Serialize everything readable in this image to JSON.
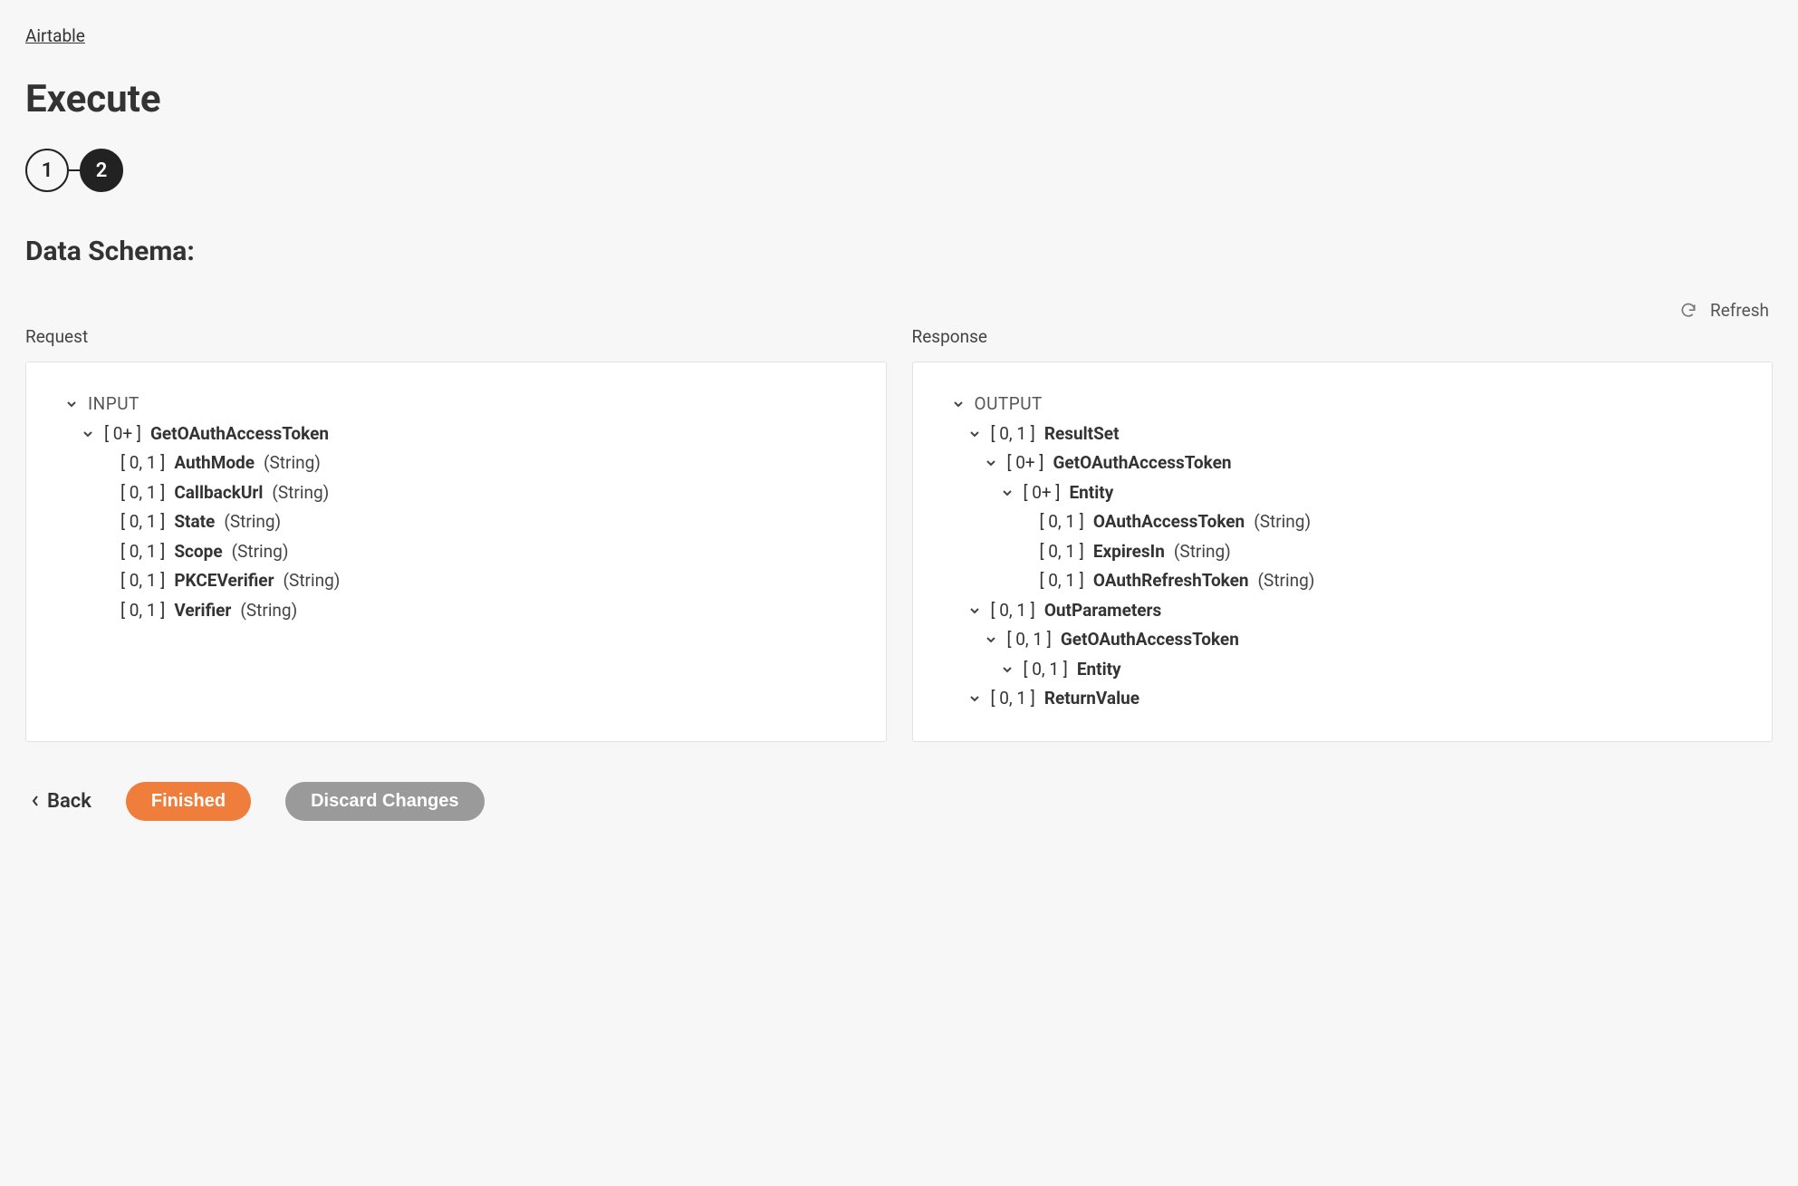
{
  "breadcrumb": "Airtable",
  "title": "Execute",
  "steps": {
    "one": "1",
    "two": "2"
  },
  "section": "Data Schema:",
  "refresh": "Refresh",
  "request": {
    "label": "Request",
    "root": "INPUT",
    "op": {
      "card": "[ 0+ ]",
      "name": "GetOAuthAccessToken"
    },
    "fields": [
      {
        "card": "[ 0, 1 ]",
        "name": "AuthMode",
        "type": "(String)"
      },
      {
        "card": "[ 0, 1 ]",
        "name": "CallbackUrl",
        "type": "(String)"
      },
      {
        "card": "[ 0, 1 ]",
        "name": "State",
        "type": "(String)"
      },
      {
        "card": "[ 0, 1 ]",
        "name": "Scope",
        "type": "(String)"
      },
      {
        "card": "[ 0, 1 ]",
        "name": "PKCEVerifier",
        "type": "(String)"
      },
      {
        "card": "[ 0, 1 ]",
        "name": "Verifier",
        "type": "(String)"
      }
    ]
  },
  "response": {
    "label": "Response",
    "root": "OUTPUT",
    "resultSet": {
      "card": "[ 0, 1 ]",
      "name": "ResultSet"
    },
    "rsOp": {
      "card": "[ 0+ ]",
      "name": "GetOAuthAccessToken"
    },
    "entity": {
      "card": "[ 0+ ]",
      "name": "Entity"
    },
    "entityFields": [
      {
        "card": "[ 0, 1 ]",
        "name": "OAuthAccessToken",
        "type": "(String)"
      },
      {
        "card": "[ 0, 1 ]",
        "name": "ExpiresIn",
        "type": "(String)"
      },
      {
        "card": "[ 0, 1 ]",
        "name": "OAuthRefreshToken",
        "type": "(String)"
      }
    ],
    "outParams": {
      "card": "[ 0, 1 ]",
      "name": "OutParameters"
    },
    "opOp": {
      "card": "[ 0, 1 ]",
      "name": "GetOAuthAccessToken"
    },
    "opEntity": {
      "card": "[ 0, 1 ]",
      "name": "Entity"
    },
    "returnValue": {
      "card": "[ 0, 1 ]",
      "name": "ReturnValue"
    }
  },
  "footer": {
    "back": "Back",
    "finished": "Finished",
    "discard": "Discard Changes"
  }
}
